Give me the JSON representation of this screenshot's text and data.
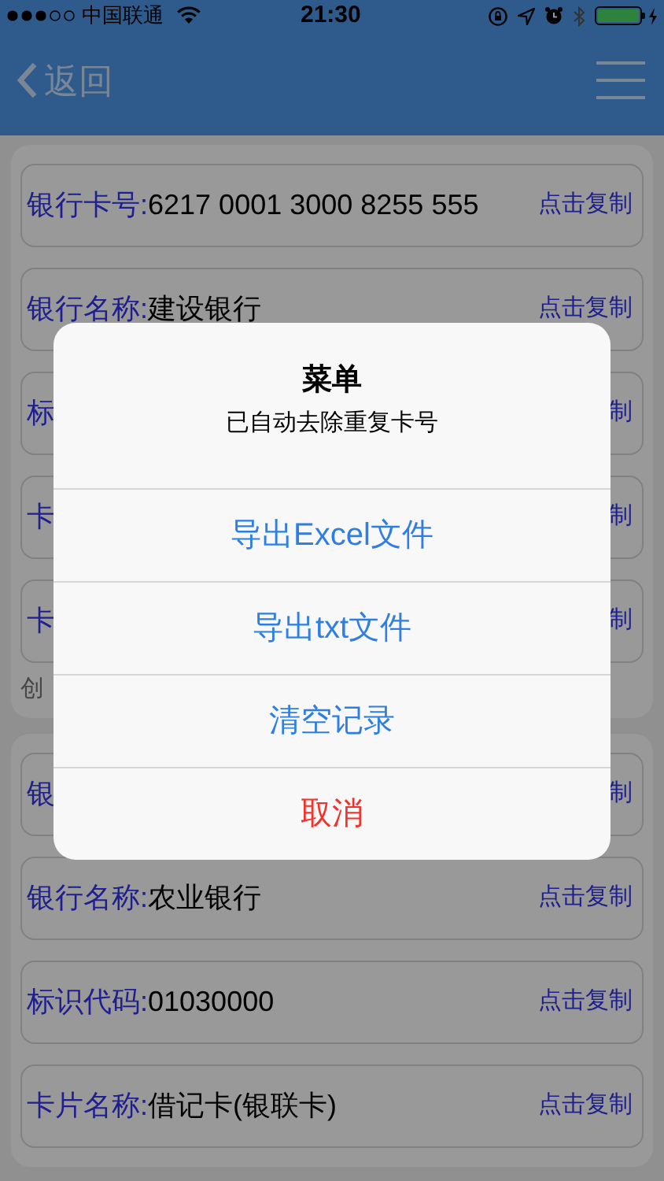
{
  "status_bar": {
    "carrier": "中国联通",
    "time": "21:30"
  },
  "nav": {
    "back": "返回"
  },
  "cards": [
    {
      "rows": [
        {
          "label": "银行卡号:",
          "value": "6217 0001 3000 8255 555",
          "copy": "点击复制"
        },
        {
          "label": "银行名称:",
          "value": "建设银行",
          "copy": "点击复制"
        },
        {
          "label": "标",
          "copy": "制"
        },
        {
          "label": "卡",
          "copy": "制"
        },
        {
          "label": "卡",
          "copy": "制"
        }
      ],
      "footer": "创"
    },
    {
      "rows": [
        {
          "label": "银",
          "copy": "制"
        },
        {
          "label": "银行名称:",
          "value": "农业银行",
          "copy": "点击复制"
        },
        {
          "label": "标识代码:",
          "value": "01030000",
          "copy": "点击复制"
        },
        {
          "label": "卡片名称:",
          "value": "借记卡(银联卡)",
          "copy": "点击复制"
        }
      ]
    }
  ],
  "dialog": {
    "title": "菜单",
    "message": "已自动去除重复卡号",
    "actions": [
      {
        "label": "导出Excel文件",
        "kind": "default"
      },
      {
        "label": "导出txt文件",
        "kind": "default"
      },
      {
        "label": "清空记录",
        "kind": "default"
      },
      {
        "label": "取消",
        "kind": "destructive"
      }
    ]
  }
}
